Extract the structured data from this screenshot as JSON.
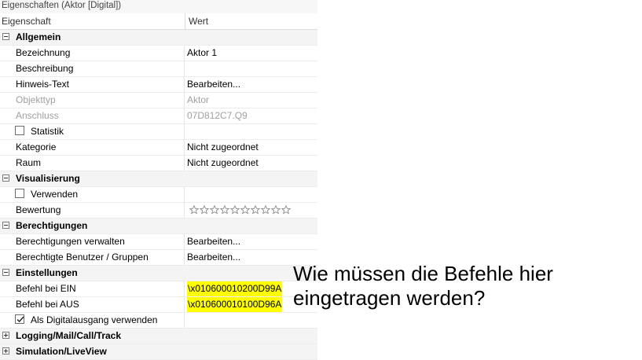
{
  "panel": {
    "title": "Eigenschaften (Aktor [Digital])",
    "header": {
      "property": "Eigenschaft",
      "value": "Wert"
    }
  },
  "rows": {
    "allgemein": "Allgemein",
    "bezeichnung": {
      "label": "Bezeichnung",
      "value": "Aktor 1"
    },
    "beschreibung": {
      "label": "Beschreibung",
      "value": ""
    },
    "hinweis": {
      "label": "Hinweis-Text",
      "value": "Bearbeiten..."
    },
    "objekttyp": {
      "label": "Objekttyp",
      "value": "Aktor"
    },
    "anschluss": {
      "label": "Anschluss",
      "value": "07D812C7.Q9"
    },
    "statistik": {
      "label": "Statistik",
      "checked": false
    },
    "kategorie": {
      "label": "Kategorie",
      "value": "Nicht zugeordnet"
    },
    "raum": {
      "label": "Raum",
      "value": "Nicht zugeordnet"
    },
    "visualisierung": "Visualisierung",
    "verwenden": {
      "label": "Verwenden",
      "checked": false
    },
    "bewertung": {
      "label": "Bewertung",
      "stars": 10,
      "filled": 0
    },
    "berechtigungen": "Berechtigungen",
    "berechtigungen_verwalten": {
      "label": "Berechtigungen verwalten",
      "value": "Bearbeiten..."
    },
    "berechtigte": {
      "label": "Berechtigte Benutzer / Gruppen",
      "value": "Bearbeiten..."
    },
    "einstellungen": "Einstellungen",
    "befehl_ein": {
      "label": "Befehl bei EIN",
      "value": "\\x010600010200D99A"
    },
    "befehl_aus": {
      "label": "Befehl bei AUS",
      "value": "\\x010600010100D96A"
    },
    "digitalausgang": {
      "label": "Als Digitalausgang verwenden",
      "checked": true
    },
    "logging": "Logging/Mail/Call/Track",
    "simulation": "Simulation/LiveView"
  },
  "annotation": {
    "line1": "Wie müssen die Befehle hier",
    "line2": "eingetragen werden?"
  },
  "colors": {
    "highlight": "#ffff00",
    "category_bg": "#f4f4f4",
    "disabled_text": "#a0a0a0"
  }
}
